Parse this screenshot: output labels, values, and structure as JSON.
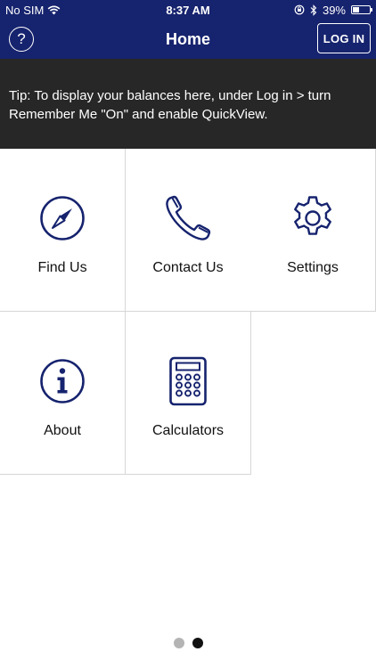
{
  "status_bar": {
    "carrier": "No SIM",
    "time": "8:37 AM",
    "battery_percent": "39%",
    "battery_level": 0.39,
    "icons": [
      "wifi-icon",
      "orientation-lock-icon",
      "bluetooth-icon",
      "battery-icon"
    ]
  },
  "header": {
    "title": "Home",
    "help_label": "?",
    "login_label": "LOG IN"
  },
  "tip": {
    "text": "Tip: To display your balances here, under Log in > turn Remember Me \"On\" and enable QuickView."
  },
  "tiles": [
    {
      "label": "Find Us",
      "icon": "compass-icon"
    },
    {
      "label": "Contact Us",
      "icon": "phone-icon"
    },
    {
      "label": "Settings",
      "icon": "gear-icon"
    },
    {
      "label": "About",
      "icon": "info-icon"
    },
    {
      "label": "Calculators",
      "icon": "calculator-icon"
    }
  ],
  "pager": {
    "pages": 2,
    "current": 2
  },
  "colors": {
    "brand": "#16236e",
    "banner": "#272727",
    "dot_inactive": "#b4b4b4",
    "dot_active": "#111111"
  }
}
